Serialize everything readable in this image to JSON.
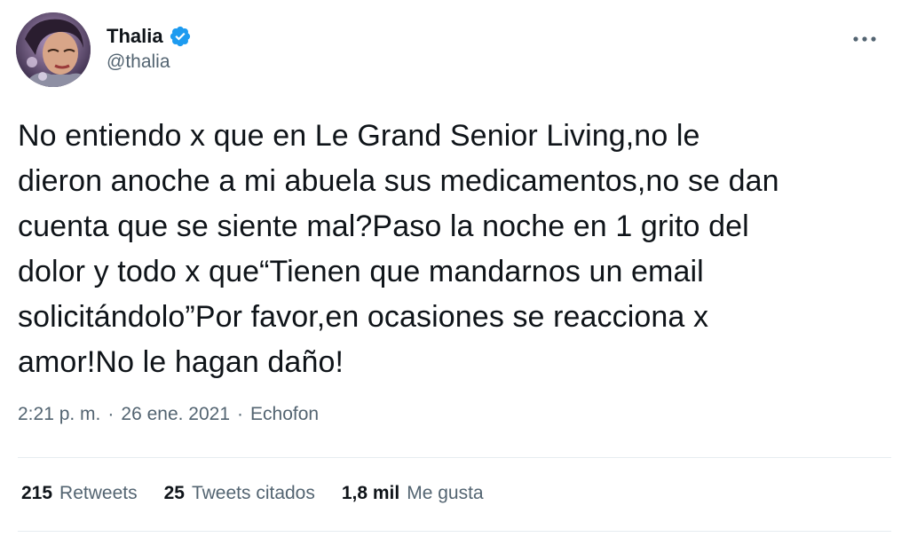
{
  "author": {
    "display_name": "Thalia",
    "handle": "@thalia",
    "verified": true,
    "avatar_icon": "profile-photo"
  },
  "tweet": {
    "text": "No entiendo x que en Le Grand Senior Living,no le\ndieron anoche a mi abuela sus medicamentos,no se dan\ncuenta que se siente mal?Paso la noche en 1 grito del\ndolor y todo x que“Tienen que mandarnos un email\nsolicitándolo”Por favor,en ocasiones se reacciona x\namor!No le hagan daño!"
  },
  "meta": {
    "time": "2:21 p. m.",
    "separator": "·",
    "date": "26 ene. 2021",
    "source": "Echofon"
  },
  "stats": [
    {
      "count": "215",
      "label": "Retweets"
    },
    {
      "count": "25",
      "label": "Tweets citados"
    },
    {
      "count": "1,8 mil",
      "label": "Me gusta"
    }
  ],
  "colors": {
    "verified": "#1d9bf0",
    "text_primary": "#0f1419",
    "text_secondary": "#536471",
    "divider": "#e6ecf0"
  },
  "icons": {
    "more": "more-horizontal-icon",
    "verified": "verified-badge-icon"
  }
}
